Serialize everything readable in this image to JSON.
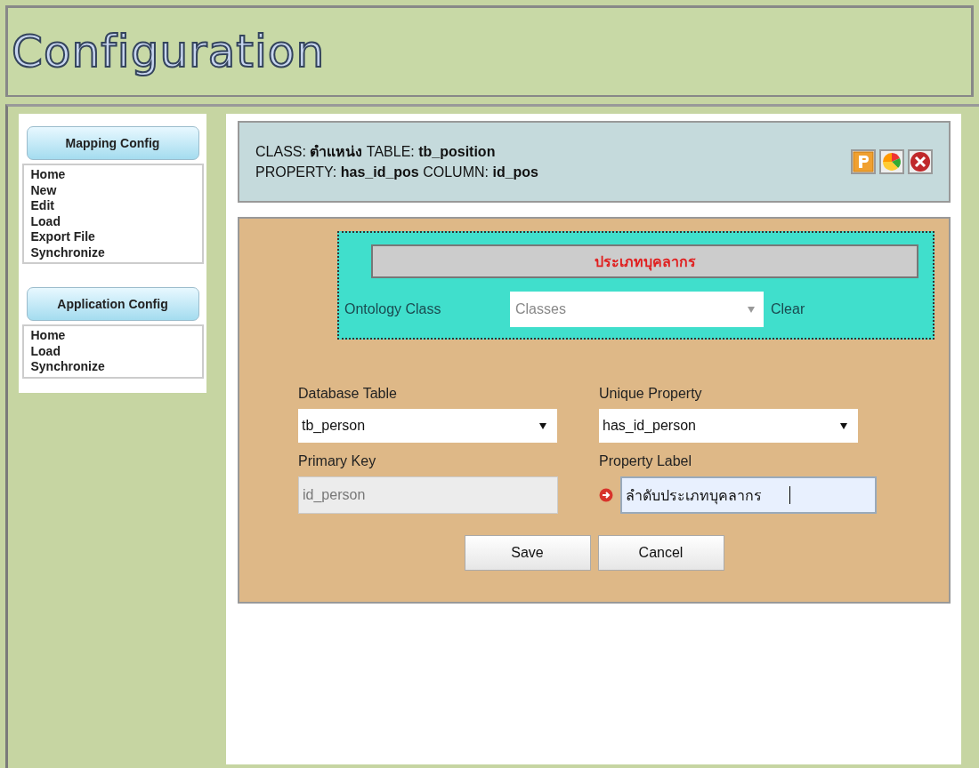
{
  "header": {
    "title": "Configuration"
  },
  "sidebar": {
    "sections": [
      {
        "title": "Mapping Config",
        "items": [
          {
            "label": "Home"
          },
          {
            "label": "New"
          },
          {
            "label": "Edit"
          },
          {
            "label": "Load"
          },
          {
            "label": "Export File"
          },
          {
            "label": "Synchronize"
          }
        ]
      },
      {
        "title": "Application Config",
        "items": [
          {
            "label": "Home"
          },
          {
            "label": "Load"
          },
          {
            "label": "Synchronize"
          }
        ]
      }
    ]
  },
  "info": {
    "lines": [
      "CLASS: **ตำแหน่ง** TABLE: **tb_position**",
      "PROPERTY: **has_id_pos** COLUMN: **id_pos**"
    ],
    "tools": [
      {
        "kind": "property"
      },
      {
        "kind": "chart"
      },
      {
        "kind": "close"
      }
    ]
  },
  "ontology": {
    "heading": "ประเภทบุคลากร",
    "label": "Ontology Class",
    "placeholder": "Classes",
    "clear": "Clear"
  },
  "fields": [
    {
      "label": "Database Table",
      "kind": "select",
      "value": "tb_person",
      "disabled": false,
      "focused": false,
      "marker": false
    },
    {
      "label": "Unique Property",
      "kind": "select",
      "value": "has_id_person",
      "disabled": false,
      "focused": false,
      "marker": false
    },
    {
      "label": "Primary Key",
      "kind": "input",
      "value": "id_person",
      "disabled": true,
      "focused": false,
      "marker": false
    },
    {
      "label": "Property Label",
      "kind": "input",
      "value": "ลำดับประเภทบุคลากร",
      "disabled": false,
      "focused": true,
      "marker": true
    }
  ],
  "buttons": [
    "Save",
    "Cancel"
  ]
}
